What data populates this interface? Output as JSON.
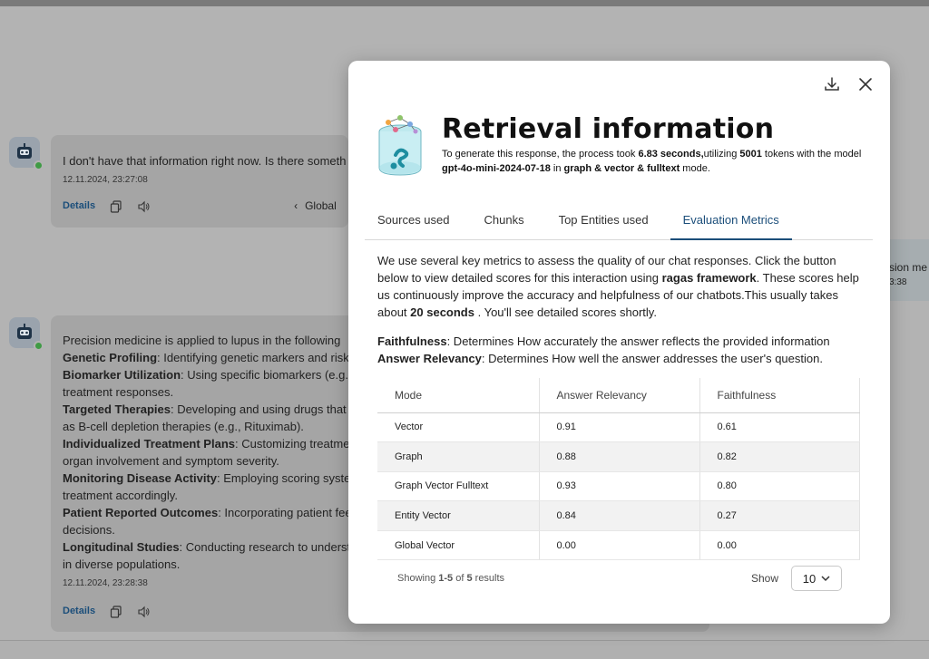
{
  "chat": {
    "messages": [
      {
        "text": "I don't have that information right now. Is there someth",
        "time": "12.11.2024, 23:27:08",
        "details_label": "Details",
        "nav_label": "Global"
      },
      {
        "intro": "Precision medicine is applied to lupus in the following",
        "items": [
          {
            "label": "Genetic Profiling",
            "text": ": Identifying genetic markers and risk"
          },
          {
            "label": "Biomarker Utilization",
            "text": ": Using specific biomarkers (e.g."
          },
          {
            "label": "",
            "text": "treatment responses."
          },
          {
            "label": "Targeted Therapies",
            "text": ": Developing and using drugs that"
          },
          {
            "label": "",
            "text": "as B-cell depletion therapies (e.g., Rituximab)."
          },
          {
            "label": "Individualized Treatment Plans",
            "text": ": Customizing treatme"
          },
          {
            "label": "",
            "text": "organ involvement and symptom severity."
          },
          {
            "label": "Monitoring Disease Activity",
            "text": ": Employing scoring syste"
          },
          {
            "label": "",
            "text": "treatment accordingly."
          },
          {
            "label": "Patient Reported Outcomes",
            "text": ": Incorporating patient fee"
          },
          {
            "label": "",
            "text": "decisions."
          },
          {
            "label": "Longitudinal Studies",
            "text": ": Conducting research to underst"
          },
          {
            "label": "",
            "text": "in diverse populations."
          }
        ],
        "time": "12.11.2024, 23:28:38",
        "details_label": "Details"
      }
    ],
    "user_message": {
      "text": "sion me",
      "time": "3:38"
    }
  },
  "modal": {
    "title": "Retrieval information",
    "subtitle": {
      "p1": "To generate this response, the process took ",
      "seconds": "6.83 seconds,",
      "p2": "utilizing ",
      "tokens": "5001",
      "p3": " tokens with the model ",
      "model": "gpt-4o-mini-2024-07-18",
      "p4": " in ",
      "mode": "graph & vector & fulltext",
      "p5": " mode."
    },
    "tabs": [
      "Sources used",
      "Chunks",
      "Top Entities used",
      "Evaluation Metrics"
    ],
    "active_tab": "Evaluation Metrics",
    "description": {
      "p1": "We use several key metrics to assess the quality of our chat responses. Click the button below to view detailed scores for this interaction using ",
      "framework": "ragas framework",
      "p2": ". These scores help us continuously improve the accuracy and helpfulness of our chatbots.This usually takes about ",
      "duration": "20 seconds",
      "p3": " . You'll see detailed scores shortly."
    },
    "metrics": [
      {
        "name": "Faithfulness",
        "text": ": Determines How accurately the answer reflects the provided information"
      },
      {
        "name": "Answer Relevancy",
        "text": ": Determines How well the answer addresses the user's question."
      }
    ],
    "table": {
      "headers": [
        "Mode",
        "Answer Relevancy",
        "Faithfulness"
      ],
      "rows": [
        [
          "Vector",
          "0.91",
          "0.61"
        ],
        [
          "Graph",
          "0.88",
          "0.82"
        ],
        [
          "Graph Vector Fulltext",
          "0.93",
          "0.80"
        ],
        [
          "Entity Vector",
          "0.84",
          "0.27"
        ],
        [
          "Global Vector",
          "0.00",
          "0.00"
        ]
      ]
    },
    "footer": {
      "showing_prefix": "Showing ",
      "range": "1-5",
      "of": " of ",
      "total": "5",
      "suffix": " results",
      "show_label": "Show",
      "page_size": "10"
    }
  },
  "colors": {
    "accent": "#1b4e7a",
    "status_online": "#3f9b45"
  }
}
